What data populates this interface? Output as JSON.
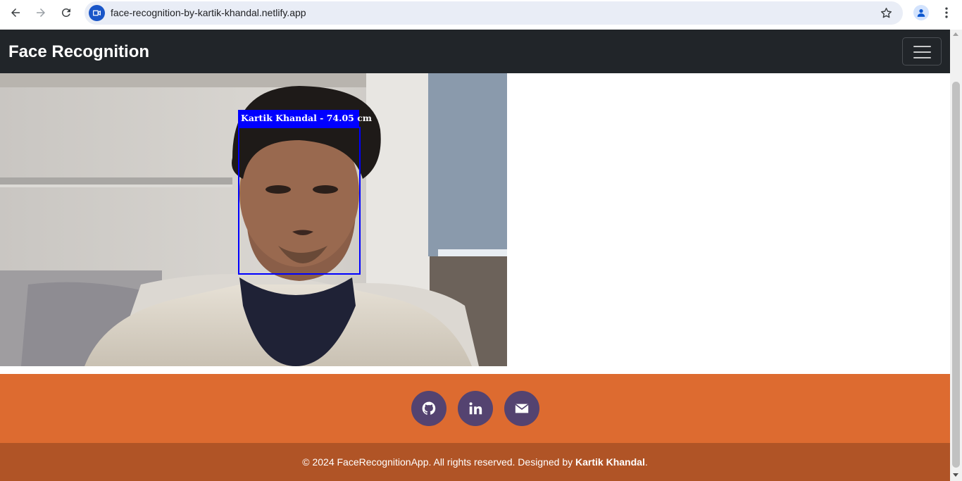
{
  "browser": {
    "url": "face-recognition-by-kartik-khandal.netlify.app"
  },
  "navbar": {
    "brand": "Face Recognition"
  },
  "detection": {
    "label": "Kartik Khandal - 74.05 cm",
    "box_color": "#0000ff"
  },
  "social_links": [
    {
      "name": "GitHub",
      "icon": "github-icon"
    },
    {
      "name": "LinkedIn",
      "icon": "linkedin-icon"
    },
    {
      "name": "Email",
      "icon": "envelope-icon"
    }
  ],
  "footer": {
    "copyright_prefix": "© 2024 FaceRecognitionApp. All rights reserved. Designed by ",
    "author": "Kartik Khandal",
    "suffix": "."
  },
  "colors": {
    "navbar_bg": "#212529",
    "social_bg": "#dd6b30",
    "copyright_bg": "#b05426",
    "social_button": "#544370"
  }
}
